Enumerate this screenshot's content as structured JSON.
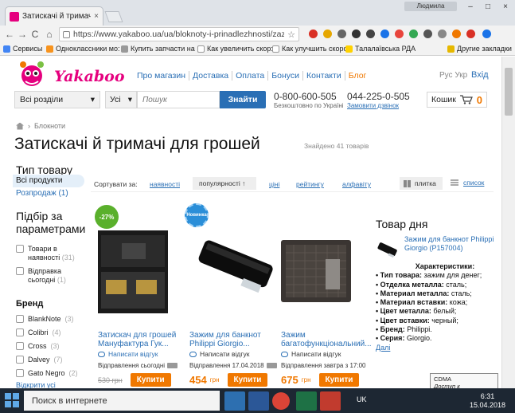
{
  "browser": {
    "tab_title": "Затискачі й тримачі для",
    "tab_close": "×",
    "user": "Людмила",
    "url": "https://www.yakaboo.ua/ua/bloknoty-i-prinadlezhnosti/zazhimy-dlj...",
    "controls": {
      "back": "←",
      "forward": "→",
      "reload": "C",
      "home": "⌂",
      "star": "☆",
      "minimize": "–",
      "maximize": "□",
      "close": "×"
    },
    "bookmarks": [
      "Сервисы",
      "Одноклассники мо:",
      "Купить запчасти на ;",
      "Как увеличить скор:",
      "Как улучшить скоро:",
      "Талалаївська РДА",
      "Другие закладки"
    ]
  },
  "site": {
    "logo": "Yakaboo",
    "nav": [
      "Про магазин",
      "Доставка",
      "Оплата",
      "Бонуси",
      "Контакти",
      "Блог"
    ],
    "lang": "Рус  Укр",
    "login": "Вхід",
    "search": {
      "category": "Всі розділи",
      "scope": "Усі",
      "placeholder": "Пошук",
      "button": "Знайти"
    },
    "phone1": "0-800-600-505",
    "phone1_sub": "Безкоштовно по Україні",
    "phone2": "044-225-0-505",
    "phone2_sub": "Замовити дзвінок",
    "cart_label": "Кошик",
    "cart_count": "0"
  },
  "breadcrumb": {
    "sep": "›",
    "item": "Блокноти"
  },
  "page": {
    "title": "Затискачі й тримачі для грошей",
    "found": "Знайдено 41 товарів"
  },
  "sidebar": {
    "type_heading": "Тип товару",
    "type_items": [
      "Всі продукти",
      "Розпродаж  (1)"
    ],
    "filter_heading": "Підбір за параметрами",
    "filters": [
      {
        "label": "Товари в наявності",
        "count": "(31)"
      },
      {
        "label": "Відправка сьогодні",
        "count": "(1)"
      }
    ],
    "brand_heading": "Бренд",
    "brands": [
      {
        "label": "BlankNote",
        "count": "(3)"
      },
      {
        "label": "Colibri",
        "count": "(4)"
      },
      {
        "label": "Cross",
        "count": "(3)"
      },
      {
        "label": "Dalvey",
        "count": "(7)"
      },
      {
        "label": "Gato Negro",
        "count": "(2)"
      }
    ],
    "show_all": "Відкрити усі"
  },
  "sort": {
    "label": "Сортувати за:",
    "options": [
      "наявності",
      "популярності",
      "ціні",
      "рейтингу",
      "алфавіту"
    ],
    "active_arrow": "↑",
    "view_tile": "плитка",
    "view_list": "список"
  },
  "products": [
    {
      "badge": "-27%",
      "title": "Затискач для грошей Мануфактура Гук...",
      "review": "Написати відгук",
      "shipping": "Відправлення сьогодні",
      "price": "",
      "currency": "",
      "old_price": "530 грн",
      "buy": "Купити"
    },
    {
      "badge": "Новинка",
      "title": "Зажим для банкнот Philippi Giorgio...",
      "review": "Написати відгук",
      "shipping": "Відправлення 17.04.2018",
      "price": "454",
      "currency": "грн",
      "old_price": "",
      "buy": "Купити"
    },
    {
      "badge": "",
      "title": "Зажим багатофункціональний...",
      "review": "Написати відгук",
      "shipping": "Відправлення завтра з 17:00",
      "price": "675",
      "currency": "грн",
      "old_price": "",
      "buy": "Купити"
    }
  ],
  "deal": {
    "heading": "Товар дня",
    "name": "Зажим для банкнот Philippi Giorgio (P157004)",
    "specs_heading": "Характеристики:",
    "specs": [
      {
        "k": "• Тип товара:",
        "v": " зажим для денег;"
      },
      {
        "k": "• Отделка металла:",
        "v": " сталь;"
      },
      {
        "k": "• Материал металла:",
        "v": " сталь;"
      },
      {
        "k": "• Материал вставки:",
        "v": " кожа;"
      },
      {
        "k": "• Цвет металла:",
        "v": " белый;"
      },
      {
        "k": "• Цвет вставки:",
        "v": " черный;"
      },
      {
        "k": "• Бренд:",
        "v": " Philippi."
      },
      {
        "k": "• Серия:",
        "v": " Giorgio."
      }
    ],
    "more": "Далі"
  },
  "taskbar": {
    "search": "Поиск в интернете",
    "tray": "UK",
    "time": "6:31",
    "date": "15.04.2018",
    "tooltip_title": "CDMA",
    "tooltip_sub": "Доступ к Интернету"
  }
}
